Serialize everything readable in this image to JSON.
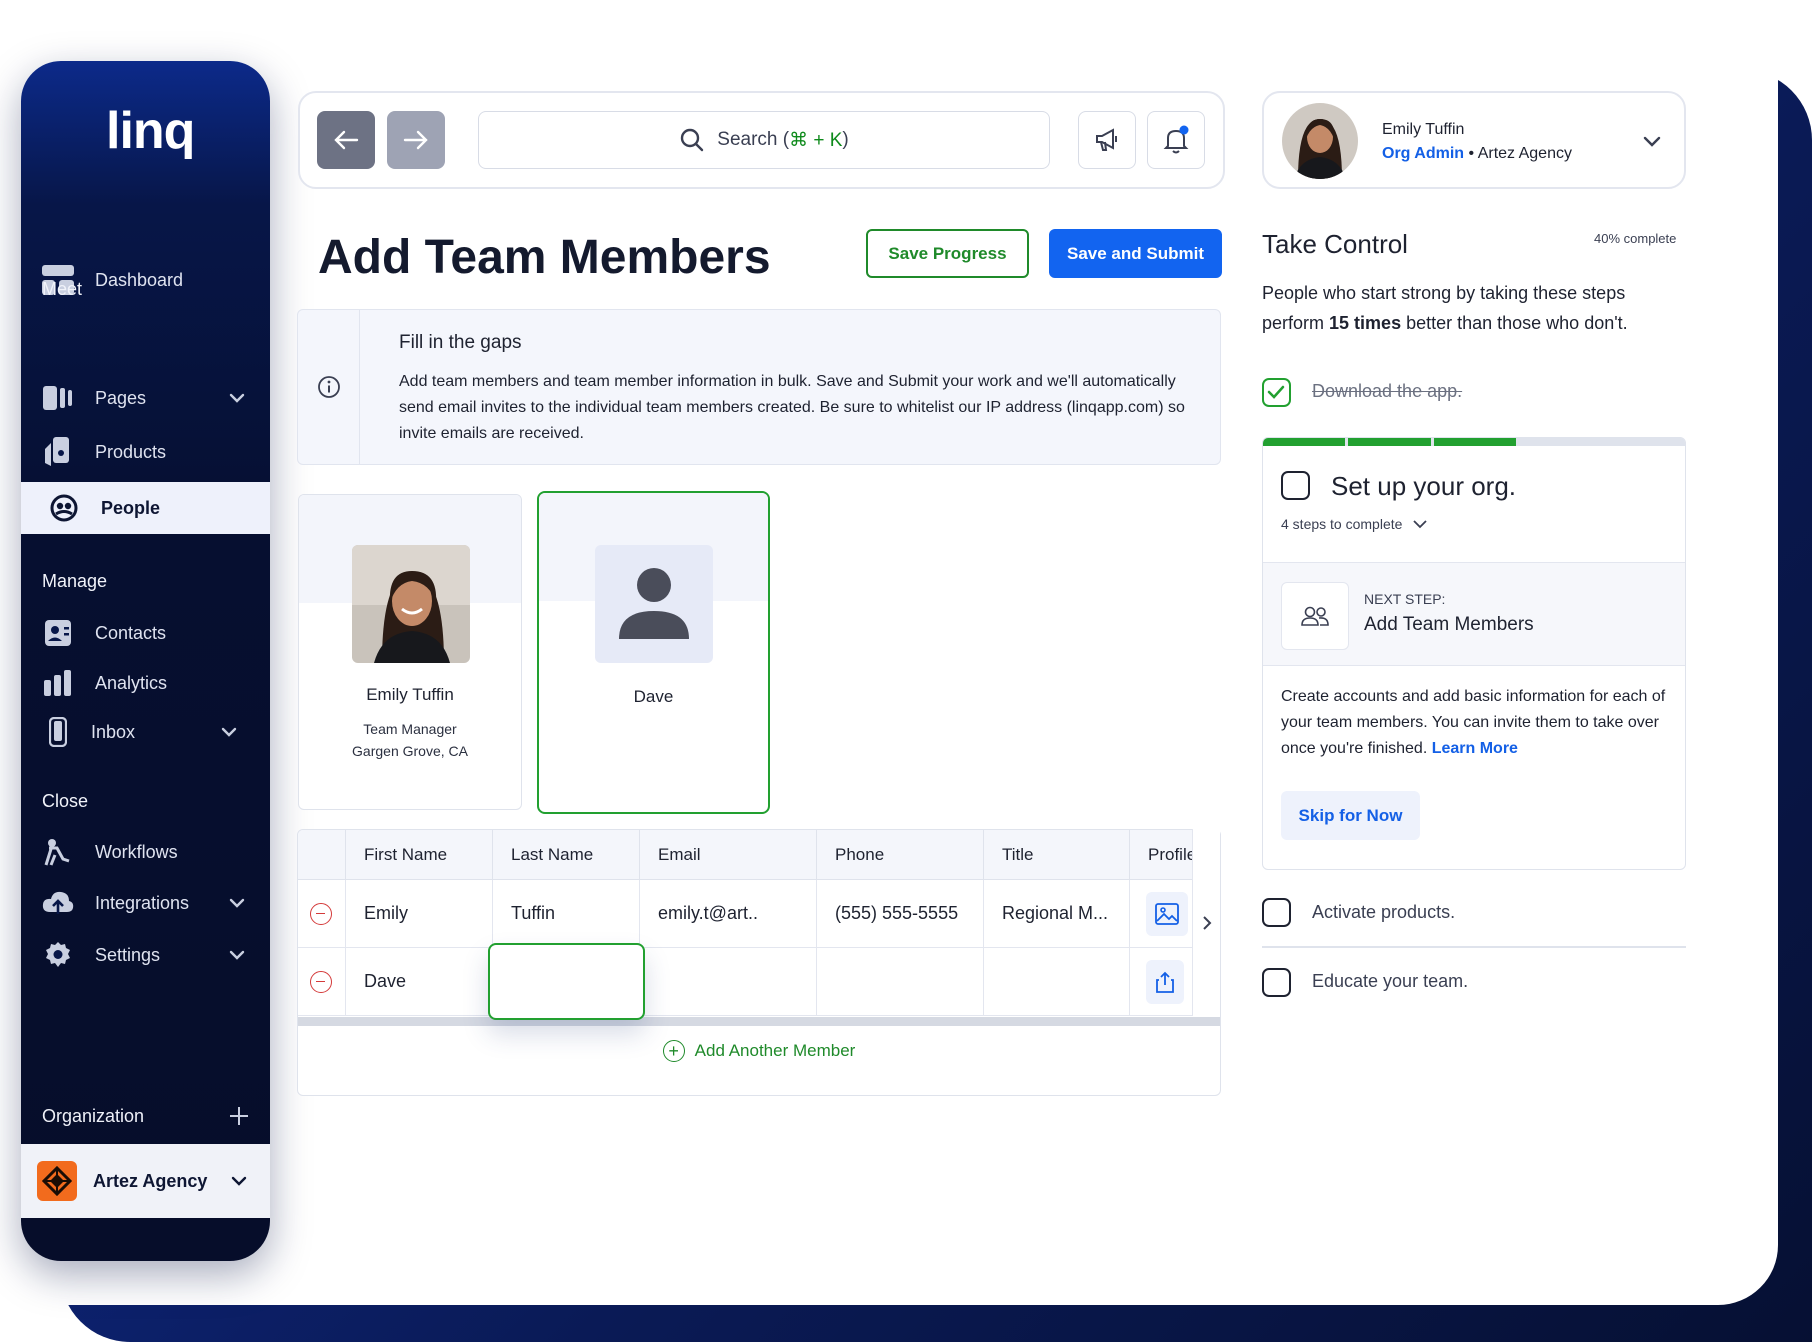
{
  "app": {
    "logo": "linq"
  },
  "sidebar": {
    "dashboard": "Dashboard",
    "meet_label": "Meet",
    "pages": "Pages",
    "products": "Products",
    "people": "People",
    "manage_label": "Manage",
    "contacts": "Contacts",
    "analytics": "Analytics",
    "inbox": "Inbox",
    "close_label": "Close",
    "workflows": "Workflows",
    "integrations": "Integrations",
    "settings": "Settings",
    "organization": "Organization",
    "agency": "Artez Agency"
  },
  "topbar": {
    "search_text": "Search (",
    "search_shortcut": "⌘ + K",
    "search_close": ")"
  },
  "page": {
    "title": "Add Team Members",
    "save_progress": "Save Progress",
    "save_submit": "Save and Submit"
  },
  "info": {
    "heading": "Fill in the gaps",
    "body": "Add team members and team member information in bulk. Save and Submit your work and we'll automatically send email invites to the individual team members created. Be sure to whitelist our IP address (linqapp.com) so invite emails are received."
  },
  "cards": [
    {
      "name": "Emily Tuffin",
      "title": "Team Manager",
      "location": "Gargen Grove, CA"
    },
    {
      "name": "Dave"
    }
  ],
  "table": {
    "columns": [
      "First Name",
      "Last Name",
      "Email",
      "Phone",
      "Title",
      "Profile"
    ],
    "rows": [
      {
        "first": "Emily",
        "last": "Tuffin",
        "email": "emily.t@art..",
        "phone": "(555) 555-5555",
        "title": "Regional M..."
      },
      {
        "first": "Dave",
        "last": "",
        "email": "",
        "phone": "",
        "title": ""
      }
    ],
    "add_member": "Add Another Member"
  },
  "profile": {
    "name": "Emily Tuffin",
    "role": "Org Admin",
    "separator": " • ",
    "org": "Artez Agency"
  },
  "take_control": {
    "title": "Take Control",
    "percent": "40% complete",
    "progress": 0.4,
    "desc_pre": "People who start strong by taking these steps perform ",
    "desc_bold": "15 times",
    "desc_post": " better than those who don't.",
    "task_download": "Download the app.",
    "task_setup": "Set up your org.",
    "steps": "4 steps to complete",
    "next_label": "NEXT STEP:",
    "next_title": "Add Team Members",
    "next_desc": "Create accounts and add basic information for each of your team members. You can invite them to take over once you're finished. ",
    "learn_more": "Learn More",
    "skip": "Skip for Now",
    "task_activate": "Activate products.",
    "task_educate": "Educate your team."
  },
  "colors": {
    "accent": "#1264f0",
    "success": "#22a030",
    "sidebar": "#060d2a"
  }
}
